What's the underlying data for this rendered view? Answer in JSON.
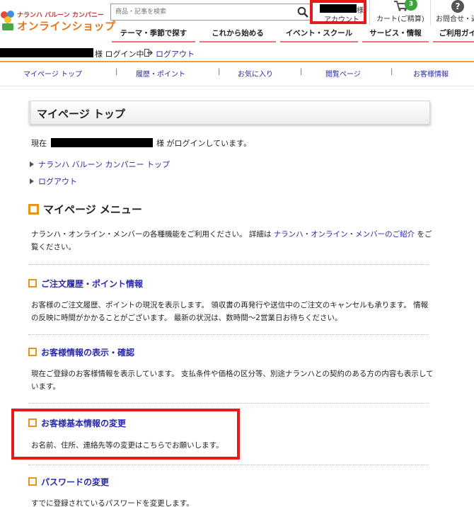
{
  "header": {
    "logo_small": "ナランハ バルーン カンパニー",
    "logo_big": "オンラインショップ",
    "search_placeholder": "商品・記事を検索",
    "account_suffix": "様",
    "account_label": "アカウント",
    "cart_label": "カート(ご精算)",
    "cart_count": "3",
    "help_label": "お問合せ・返"
  },
  "gnav": [
    "テーマ・季節で探す",
    "これから始める",
    "イベント・スクール",
    "サービス・情報",
    "ご利用ガイド"
  ],
  "loginbar": {
    "status": "様 ログイン中",
    "logout": "ログアウト"
  },
  "subnav": [
    "マイページ トップ",
    "履歴・ポイント",
    "お気に入り",
    "閲覧ページ",
    "お客様情報"
  ],
  "main": {
    "title": "マイページ トップ",
    "current_prefix": "現在",
    "current_suffix": "様 がログインしています。",
    "links": [
      "ナランハ バルーン カンパニー トップ",
      "ログアウト"
    ],
    "menu_heading": "マイページ メニュー",
    "intro_part1": "ナランハ・オンライン・メンバーの各種機能をご利用ください。 詳細は ",
    "intro_link": "ナランハ・オンライン・メンバーのご紹介",
    "intro_part2": " をご覧ください。",
    "sections": [
      {
        "heading": "ご注文履歴・ポイント情報",
        "text": "お客様のご注文履歴、ポイントの現況を表示します。 領収書の再発行や送信中のご注文のキャンセルも承ります。 情報の反映に時間がかかることがございます。 最新の状況は、数時間～2営業日お待ちください。"
      },
      {
        "heading": "お客様情報の表示・確認",
        "text": "現在ご登録のお客様情報を表示しています。 支払条件や価格の区分等、別途ナランハとの契約のある方の内容も表示しています。"
      },
      {
        "heading": "お客様基本情報の変更",
        "text": "お名前、住所、連絡先等の変更はこちらでお願いします。"
      },
      {
        "heading": "パスワードの変更",
        "text": "すでに登録されているパスワードを変更します。"
      }
    ]
  },
  "colors": {
    "accent_orange": "#e6941c",
    "highlight_red": "#e41b1b",
    "link_blue": "#2a2aa8",
    "cart_badge": "#3aa63a"
  }
}
